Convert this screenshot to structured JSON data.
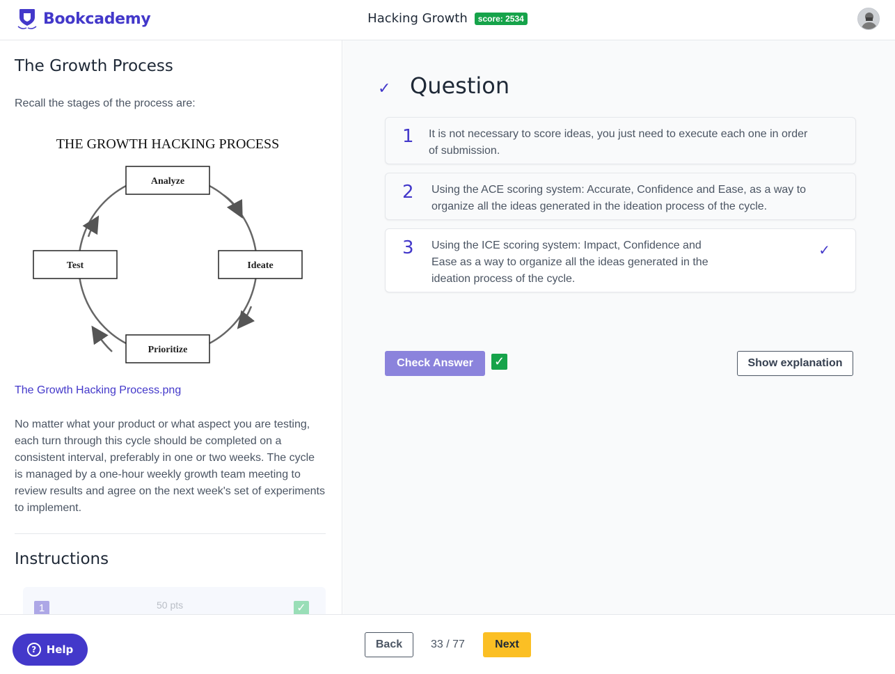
{
  "header": {
    "brand": "Bookcademy",
    "course_title": "Hacking Growth",
    "score": "score: 2534"
  },
  "lesson": {
    "title": "The Growth Process",
    "recall": "Recall the stages of the process are:",
    "diagram": {
      "title": "THE GROWTH HACKING PROCESS",
      "stages": [
        "Analyze",
        "Ideate",
        "Prioritize",
        "Test"
      ]
    },
    "image_link": "The Growth Hacking Process.png",
    "paragraph": "No matter what your product or what aspect you are testing, each turn through this cycle should be completed on a consistent interval, preferably in one or two weeks. The cycle is managed by a one-hour weekly growth team meeting to review results and agree on the next week's set of experiments to implement.",
    "instructions_title": "Instructions",
    "instruction_item": {
      "number": "1",
      "points": "50 pts"
    }
  },
  "question": {
    "title": "Question",
    "options": [
      {
        "number": "1",
        "lines": [
          "It is not necessary to score ideas, you just need to execute each one in order",
          "of submission."
        ]
      },
      {
        "number": "2",
        "lines": [
          "Using the ACE scoring system: Accurate, Confidence and Ease, as a way to",
          "organize all the ideas generated in the ideation process of the cycle."
        ]
      },
      {
        "number": "3",
        "lines": [
          "Using the ICE scoring system: Impact, Confidence and",
          "Ease as a way to organize all the ideas generated in the",
          "ideation process of the cycle."
        ]
      }
    ],
    "check_button": "Check Answer",
    "explanation_button": "Show explanation"
  },
  "footer": {
    "help": "Help",
    "back": "Back",
    "page": "33 / 77",
    "next": "Next"
  },
  "colors": {
    "brand": "#4338ca",
    "score_badge": "#16a34a",
    "check_button": "#8b83dc",
    "next_button": "#fbbf24"
  }
}
